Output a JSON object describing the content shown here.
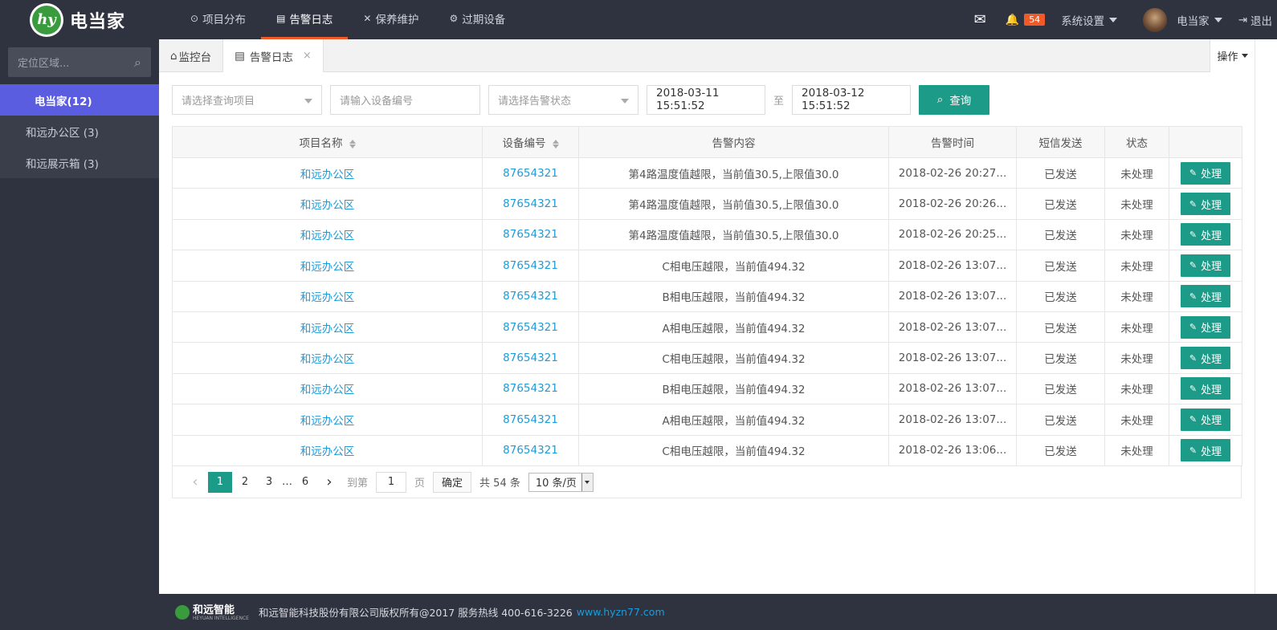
{
  "app": {
    "name": "电当家",
    "logo_letters": "hy"
  },
  "nav": [
    {
      "label": "项目分布",
      "icon": "location-pin-icon",
      "glyph": "⊙",
      "active": false
    },
    {
      "label": "告警日志",
      "icon": "clipboard-icon",
      "glyph": "▤",
      "active": true
    },
    {
      "label": "保养维护",
      "icon": "tools-icon",
      "glyph": "✕",
      "active": false
    },
    {
      "label": "过期设备",
      "icon": "gear-icon",
      "glyph": "⚙",
      "active": false
    }
  ],
  "topright": {
    "mail_glyph": "✉",
    "bell_glyph": "🔔",
    "badge": "54",
    "settings": "系统设置",
    "user": "电当家",
    "logout_glyph": "⇥",
    "logout": "退出"
  },
  "sidebar": {
    "search_placeholder": "定位区域...",
    "search_glyph": "⌕",
    "items": [
      {
        "label": "电当家(12)",
        "active": true
      },
      {
        "label": "和远办公区 (3)",
        "active": false
      },
      {
        "label": "和远展示箱 (3)",
        "active": false
      }
    ]
  },
  "tabs": [
    {
      "label": "监控台",
      "glyph": "⌂",
      "active": false
    },
    {
      "label": "告警日志",
      "glyph": "▤",
      "active": true,
      "close": "×"
    }
  ],
  "ops_label": "操作",
  "filters": {
    "project_placeholder": "请选择查询项目",
    "device_placeholder": "请输入设备编号",
    "status_placeholder": "请选择告警状态",
    "start": "2018-03-11 15:51:52",
    "to": "至",
    "end": "2018-03-12 15:51:52",
    "query": "查询",
    "query_glyph": "⌕"
  },
  "table": {
    "headers": [
      "项目名称",
      "设备编号",
      "告警内容",
      "告警时间",
      "短信发送",
      "状态",
      ""
    ],
    "action_label": "处理",
    "action_glyph": "✎",
    "rows": [
      [
        "和远办公区",
        "87654321",
        "第4路温度值越限，当前值30.5,上限值30.0",
        "2018-02-26 20:27...",
        "已发送",
        "未处理"
      ],
      [
        "和远办公区",
        "87654321",
        "第4路温度值越限，当前值30.5,上限值30.0",
        "2018-02-26 20:26...",
        "已发送",
        "未处理"
      ],
      [
        "和远办公区",
        "87654321",
        "第4路温度值越限，当前值30.5,上限值30.0",
        "2018-02-26 20:25...",
        "已发送",
        "未处理"
      ],
      [
        "和远办公区",
        "87654321",
        "C相电压越限，当前值494.32",
        "2018-02-26 13:07...",
        "已发送",
        "未处理"
      ],
      [
        "和远办公区",
        "87654321",
        "B相电压越限，当前值494.32",
        "2018-02-26 13:07...",
        "已发送",
        "未处理"
      ],
      [
        "和远办公区",
        "87654321",
        "A相电压越限，当前值494.32",
        "2018-02-26 13:07...",
        "已发送",
        "未处理"
      ],
      [
        "和远办公区",
        "87654321",
        "C相电压越限，当前值494.32",
        "2018-02-26 13:07...",
        "已发送",
        "未处理"
      ],
      [
        "和远办公区",
        "87654321",
        "B相电压越限，当前值494.32",
        "2018-02-26 13:07...",
        "已发送",
        "未处理"
      ],
      [
        "和远办公区",
        "87654321",
        "A相电压越限，当前值494.32",
        "2018-02-26 13:07...",
        "已发送",
        "未处理"
      ],
      [
        "和远办公区",
        "87654321",
        "C相电压越限，当前值494.32",
        "2018-02-26 13:06...",
        "已发送",
        "未处理"
      ]
    ]
  },
  "pager": {
    "prev": "‹",
    "pages": [
      "1",
      "2",
      "3",
      "…",
      "6"
    ],
    "next": "›",
    "goto": "到第",
    "page_value": "1",
    "page_unit": "页",
    "confirm": "确定",
    "total": "共 54 条",
    "size": "10 条/页"
  },
  "footer": {
    "logo": "和远智能",
    "logo_sub": "HEYUAN INTELLIGENCE",
    "text": "和远智能科技股份有限公司版权所有@2017 服务热线 400-616-3226",
    "link": "www.hyzn77.com"
  },
  "colors": {
    "accent": "#1c9b88",
    "active_side": "#5b5de0",
    "nav_underline": "#f05a28",
    "link": "#1e9bd7"
  }
}
